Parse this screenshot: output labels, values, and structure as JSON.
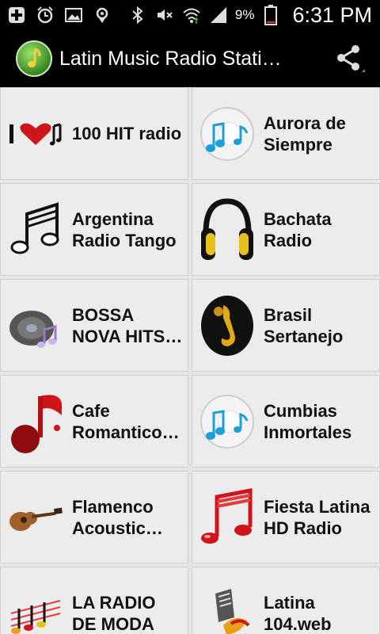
{
  "status_bar": {
    "battery_percent": "9%",
    "time": "6:31 PM",
    "icons": [
      "add-icon",
      "alarm-icon",
      "image-icon",
      "location-icon",
      "bluetooth-icon",
      "mute-icon",
      "wifi-icon",
      "signal-icon",
      "battery-icon"
    ]
  },
  "action_bar": {
    "title": "Latin Music Radio Stati…",
    "logo_icon": "music-note-logo",
    "share_icon": "share-icon"
  },
  "stations": [
    {
      "label": "100 HIT radio",
      "icon": "i-love-music-icon"
    },
    {
      "label": "Aurora de Siempre",
      "icon": "music-cd-icon"
    },
    {
      "label": "Argentina Radio Tango",
      "icon": "music-notes-icon"
    },
    {
      "label": "Bachata Radio",
      "icon": "headphones-icon"
    },
    {
      "label": "BOSSA NOVA HITS…",
      "icon": "vinyl-disc-icon"
    },
    {
      "label": "Brasil Sertanejo",
      "icon": "saxophone-player-icon"
    },
    {
      "label": "Cafe Romantico…",
      "icon": "red-music-note-icon"
    },
    {
      "label": "Cumbias Inmortales",
      "icon": "music-cd-icon"
    },
    {
      "label": "Flamenco Acoustic…",
      "icon": "guitar-icon"
    },
    {
      "label": "Fiesta Latina HD Radio",
      "icon": "red-music-notes-icon"
    },
    {
      "label": "LA RADIO DE MODA",
      "icon": "colorful-music-notes-icon"
    },
    {
      "label": "Latina 104.web",
      "icon": "keyboard-music-icon"
    }
  ],
  "colors": {
    "bar_bg": "#000000",
    "tile_bg": "#ececec",
    "accent_green": "#5aa83a",
    "accent_red": "#d0141c"
  }
}
